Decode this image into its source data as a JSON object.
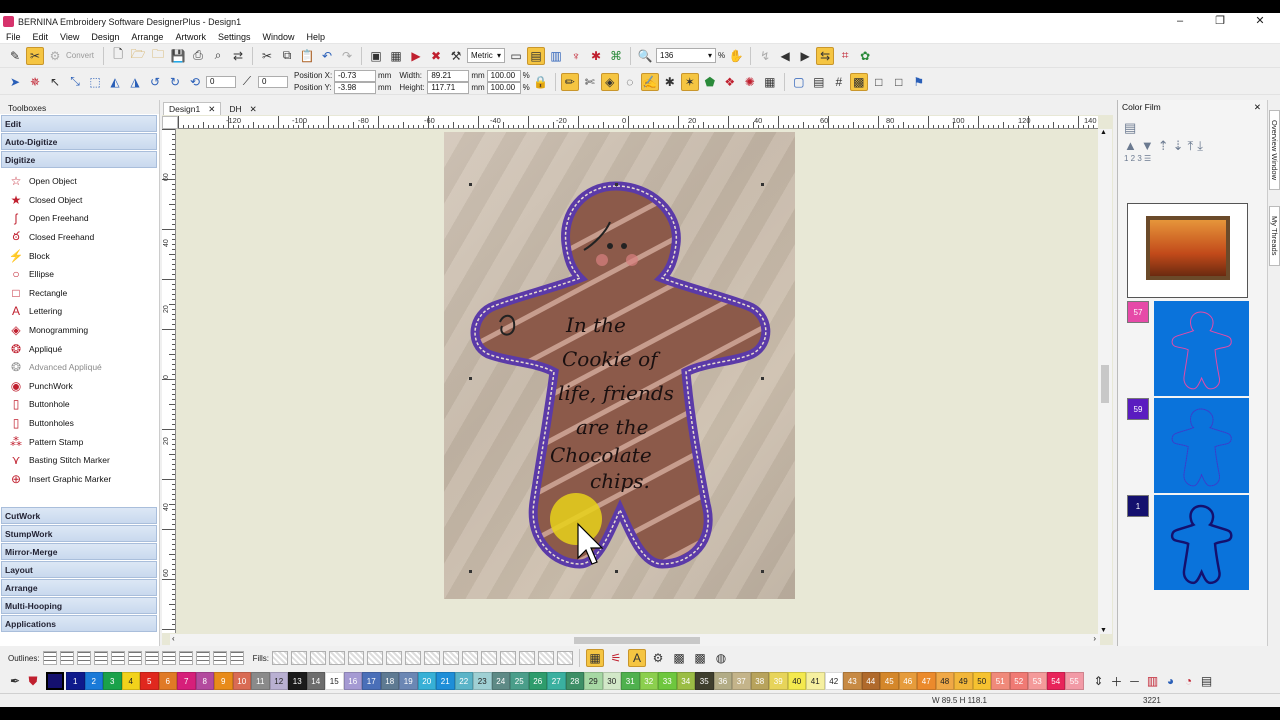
{
  "window": {
    "title": "BERNINA Embroidery Software DesignerPlus - Design1",
    "minimize": "–",
    "maximize": "❐",
    "close": "✕"
  },
  "menu": [
    "File",
    "Edit",
    "View",
    "Design",
    "Arrange",
    "Artwork",
    "Settings",
    "Window",
    "Help"
  ],
  "toolbar1": {
    "convert_label": "Convert",
    "units_value": "Metric",
    "zoom_value": "136",
    "zoom_unit": "%"
  },
  "toolbar2": {
    "position_x_label": "Position X:",
    "position_x_value": "-0.73",
    "position_y_label": "Position Y:",
    "position_y_value": "-3.98",
    "width_label": "Width:",
    "width_value": "89.21",
    "height_label": "Height:",
    "height_value": "117.71",
    "scale_w": "100.00",
    "scale_h": "100.00",
    "unit": "mm",
    "pct": "%",
    "rotate_value": "0",
    "slant_value": "0"
  },
  "toolboxes": {
    "title": "Toolboxes",
    "sections_top": [
      "Edit",
      "Auto-Digitize",
      "Digitize"
    ],
    "tools": [
      {
        "label": "Open Object",
        "icon": "star-outline-icon",
        "disabled": false
      },
      {
        "label": "Closed Object",
        "icon": "star-filled-icon",
        "disabled": false
      },
      {
        "label": "Open Freehand",
        "icon": "freehand-open-icon",
        "disabled": false
      },
      {
        "label": "Closed Freehand",
        "icon": "freehand-closed-icon",
        "disabled": false
      },
      {
        "label": "Block",
        "icon": "block-icon",
        "disabled": false
      },
      {
        "label": "Ellipse",
        "icon": "ellipse-icon",
        "disabled": false
      },
      {
        "label": "Rectangle",
        "icon": "rectangle-icon",
        "disabled": false
      },
      {
        "label": "Lettering",
        "icon": "lettering-icon",
        "disabled": false
      },
      {
        "label": "Monogramming",
        "icon": "monogram-icon",
        "disabled": false
      },
      {
        "label": "Appliqué",
        "icon": "applique-icon",
        "disabled": false
      },
      {
        "label": "Advanced Appliqué",
        "icon": "advanced-applique-icon",
        "disabled": true
      },
      {
        "label": "PunchWork",
        "icon": "punchwork-icon",
        "disabled": false
      },
      {
        "label": "Buttonhole",
        "icon": "buttonhole-icon",
        "disabled": false
      },
      {
        "label": "Buttonholes",
        "icon": "buttonholes-icon",
        "disabled": false
      },
      {
        "label": "Pattern Stamp",
        "icon": "pattern-stamp-icon",
        "disabled": false
      },
      {
        "label": "Basting Stitch Marker",
        "icon": "basting-marker-icon",
        "disabled": false
      },
      {
        "label": "Insert Graphic Marker",
        "icon": "graphic-marker-icon",
        "disabled": false
      }
    ],
    "sections_bottom": [
      "CutWork",
      "StumpWork",
      "Mirror-Merge",
      "Layout",
      "Arrange",
      "Multi-Hooping",
      "Applications"
    ]
  },
  "tabs": [
    {
      "label": "Design1",
      "close": "✕"
    },
    {
      "label": "DH",
      "close": "✕"
    }
  ],
  "ruler": {
    "h_labels": [
      "-120",
      "-100",
      "-80",
      "-60",
      "-40",
      "-20",
      "0",
      "20",
      "40",
      "60",
      "80",
      "100",
      "120",
      "140"
    ],
    "v_labels": [
      "60",
      "40",
      "20",
      "0",
      "20",
      "40",
      "60"
    ]
  },
  "design_text": [
    "In the",
    "Cookie of",
    "life, friends",
    "are the",
    "Chocolate",
    "chips."
  ],
  "color_film": {
    "title": "Color Film",
    "items": [
      {
        "number": "57",
        "color": "#e64aa8"
      },
      {
        "number": "59",
        "color": "#5a1cc0"
      },
      {
        "number": "1",
        "color": "#14106e"
      }
    ]
  },
  "side_tabs": [
    "Overview Window",
    "My Threads"
  ],
  "bottom": {
    "outlines_label": "Outlines:",
    "fills_label": "Fills:"
  },
  "palette": [
    {
      "n": "1",
      "c": "#0e1a8c"
    },
    {
      "n": "2",
      "c": "#1a7ad8"
    },
    {
      "n": "3",
      "c": "#1aa24a"
    },
    {
      "n": "4",
      "c": "#f2d21b"
    },
    {
      "n": "5",
      "c": "#e0281e"
    },
    {
      "n": "6",
      "c": "#e07a26"
    },
    {
      "n": "7",
      "c": "#d61f7a"
    },
    {
      "n": "8",
      "c": "#b34a9e"
    },
    {
      "n": "9",
      "c": "#e88b1a"
    },
    {
      "n": "10",
      "c": "#d96b54"
    },
    {
      "n": "11",
      "c": "#8a8a8a"
    },
    {
      "n": "12",
      "c": "#b9b0d2"
    },
    {
      "n": "13",
      "c": "#1b1b1b"
    },
    {
      "n": "14",
      "c": "#6d6d6d"
    },
    {
      "n": "15",
      "c": "#ffffff"
    },
    {
      "n": "16",
      "c": "#a59ad3"
    },
    {
      "n": "17",
      "c": "#4a6fb8"
    },
    {
      "n": "18",
      "c": "#5e7a92"
    },
    {
      "n": "19",
      "c": "#6b87b4"
    },
    {
      "n": "20",
      "c": "#37b0d6"
    },
    {
      "n": "21",
      "c": "#1e8ed8"
    },
    {
      "n": "22",
      "c": "#5ab4c8"
    },
    {
      "n": "23",
      "c": "#9fd0d4"
    },
    {
      "n": "24",
      "c": "#5e8a86"
    },
    {
      "n": "25",
      "c": "#4a9e8a"
    },
    {
      "n": "26",
      "c": "#2e9c6c"
    },
    {
      "n": "27",
      "c": "#3ab0a0"
    },
    {
      "n": "28",
      "c": "#3d8f66"
    },
    {
      "n": "29",
      "c": "#a6d8a4"
    },
    {
      "n": "30",
      "c": "#d2e8c8"
    },
    {
      "n": "31",
      "c": "#4fb14e"
    },
    {
      "n": "32",
      "c": "#8ccf4e"
    },
    {
      "n": "33",
      "c": "#6ec73e"
    },
    {
      "n": "34",
      "c": "#9bbd45"
    },
    {
      "n": "35",
      "c": "#3f3f2e"
    },
    {
      "n": "36",
      "c": "#b2ac86"
    },
    {
      "n": "37",
      "c": "#c4b48a"
    },
    {
      "n": "38",
      "c": "#b8a35c"
    },
    {
      "n": "39",
      "c": "#e7d45a"
    },
    {
      "n": "40",
      "c": "#f4e94e"
    },
    {
      "n": "41",
      "c": "#f6f0a0"
    },
    {
      "n": "42",
      "c": "#ffffff"
    },
    {
      "n": "43",
      "c": "#c78a44"
    },
    {
      "n": "44",
      "c": "#b06a2c"
    },
    {
      "n": "45",
      "c": "#d4872a"
    },
    {
      "n": "46",
      "c": "#e69c3c"
    },
    {
      "n": "47",
      "c": "#eb8a2c"
    },
    {
      "n": "48",
      "c": "#f0a846"
    },
    {
      "n": "49",
      "c": "#f2b63a"
    },
    {
      "n": "50",
      "c": "#f6c230"
    },
    {
      "n": "51",
      "c": "#f08a7a"
    },
    {
      "n": "52",
      "c": "#f07a74"
    },
    {
      "n": "53",
      "c": "#f49a9a"
    },
    {
      "n": "54",
      "c": "#e8245a"
    },
    {
      "n": "55",
      "c": "#f29aa6"
    }
  ],
  "status": {
    "dimensions": "W 89.5 H 118.1",
    "count": "3221"
  }
}
